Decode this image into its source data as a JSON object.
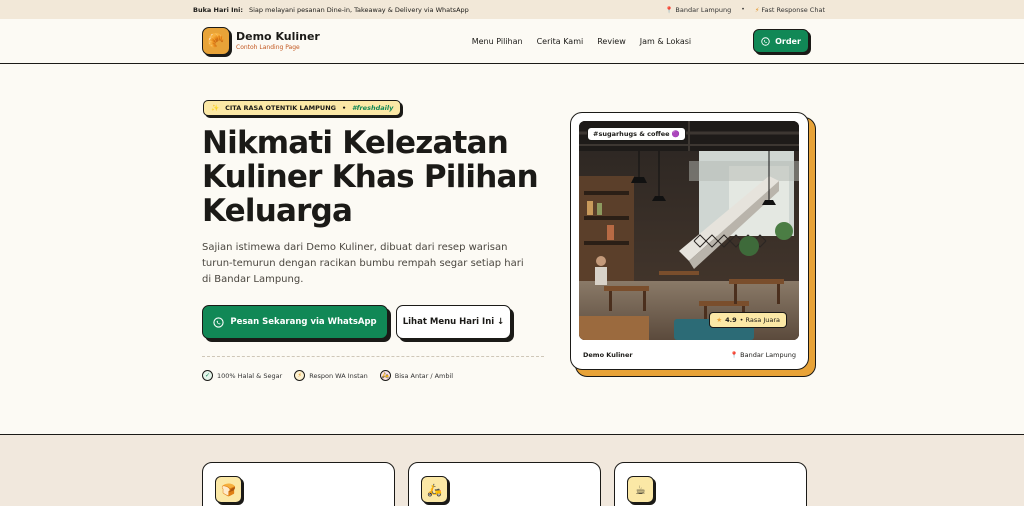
{
  "topbar": {
    "open_label": "Buka Hari Ini:",
    "open_text": "Siap melayani pesanan Dine-in, Takeaway & Delivery via WhatsApp",
    "location": "Bandar Lampung",
    "separator": "•",
    "response": "Fast Response Chat"
  },
  "header": {
    "brand_name": "Demo Kuliner",
    "brand_sub": "Contoh Landing Page",
    "nav": [
      "Menu Pilihan",
      "Cerita Kami",
      "Review",
      "Jam & Lokasi"
    ],
    "order_label": "Order"
  },
  "hero": {
    "chip_text": "CITA RASA OTENTIK LAMPUNG",
    "chip_sep": "•",
    "chip_tag": "#freshdaily",
    "title": "Nikmati Kelezatan Kuliner Khas Pilihan Keluarga",
    "description": "Sajian istimewa dari Demo Kuliner, dibuat dari resep warisan turun-temurun dengan racikan bumbu rempah segar setiap hari di Bandar Lampung.",
    "primary_button": "Pesan Sekarang via WhatsApp",
    "secondary_button": "Lihat Menu Hari Ini ↓",
    "features": [
      {
        "icon": "check-icon",
        "label": "100% Halal & Segar"
      },
      {
        "icon": "bolt-icon",
        "label": "Respon WA Instan"
      },
      {
        "icon": "scooter-icon",
        "label": "Bisa Antar / Ambil"
      }
    ]
  },
  "photo_card": {
    "tag": "#sugarhugs & coffee 🟣",
    "rating_value": "4.9",
    "rating_text": "• Rasa Juara",
    "brand": "Demo Kuliner",
    "location": "Bandar Lampung"
  },
  "lower": {
    "cards": [
      {
        "icon": "bread-icon",
        "glyph": "🍞"
      },
      {
        "icon": "delivery-icon",
        "glyph": "🛵"
      },
      {
        "icon": "coffee-icon",
        "glyph": "☕"
      }
    ]
  },
  "colors": {
    "accent_green": "#118856",
    "accent_orange": "#e8a338",
    "chip_yellow": "#fbe8a6",
    "ink": "#1b1a17"
  }
}
